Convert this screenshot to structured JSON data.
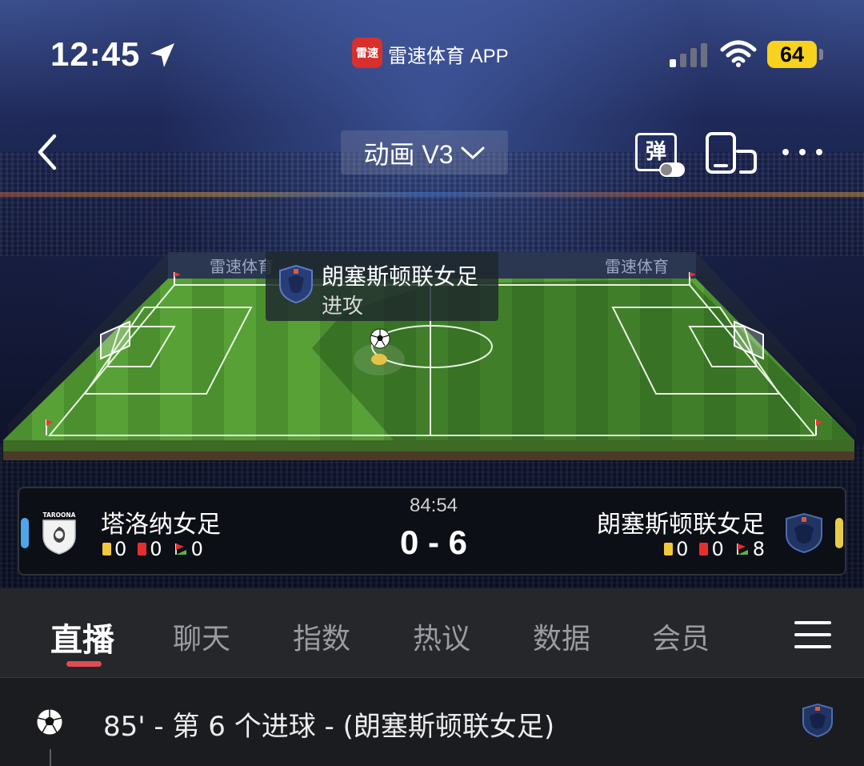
{
  "status_bar": {
    "time": "12:45",
    "app_badge": "雷速",
    "app_name": "雷速体育 APP",
    "battery": "64"
  },
  "nav": {
    "mode_label": "动画 V3",
    "danmu_label": "弹"
  },
  "pitch": {
    "ad_text": "雷速体育",
    "event": {
      "team": "朗塞斯顿联女足",
      "type": "进攻"
    }
  },
  "match": {
    "clock": "84:54",
    "score": "0 - 6",
    "home": {
      "name": "塔洛纳女足",
      "crest_text": "TAROONA",
      "yellow_cards": "0",
      "red_cards": "0",
      "corners": "0",
      "color": "#4ea6ea"
    },
    "away": {
      "name": "朗塞斯顿联女足",
      "yellow_cards": "0",
      "red_cards": "0",
      "corners": "8",
      "color": "#e9cc46"
    }
  },
  "tabs": [
    {
      "label": "直播",
      "active": true
    },
    {
      "label": "聊天"
    },
    {
      "label": "指数"
    },
    {
      "label": "热议"
    },
    {
      "label": "数据"
    },
    {
      "label": "会员"
    }
  ],
  "feed": [
    {
      "text": "85' - 第 6 个进球 - (朗塞斯顿联女足)",
      "icon": "soccer-ball-icon"
    }
  ],
  "colors": {
    "accent_red": "#e14b52",
    "background": "#1a1b1f",
    "tab_bar": "#25272b"
  }
}
